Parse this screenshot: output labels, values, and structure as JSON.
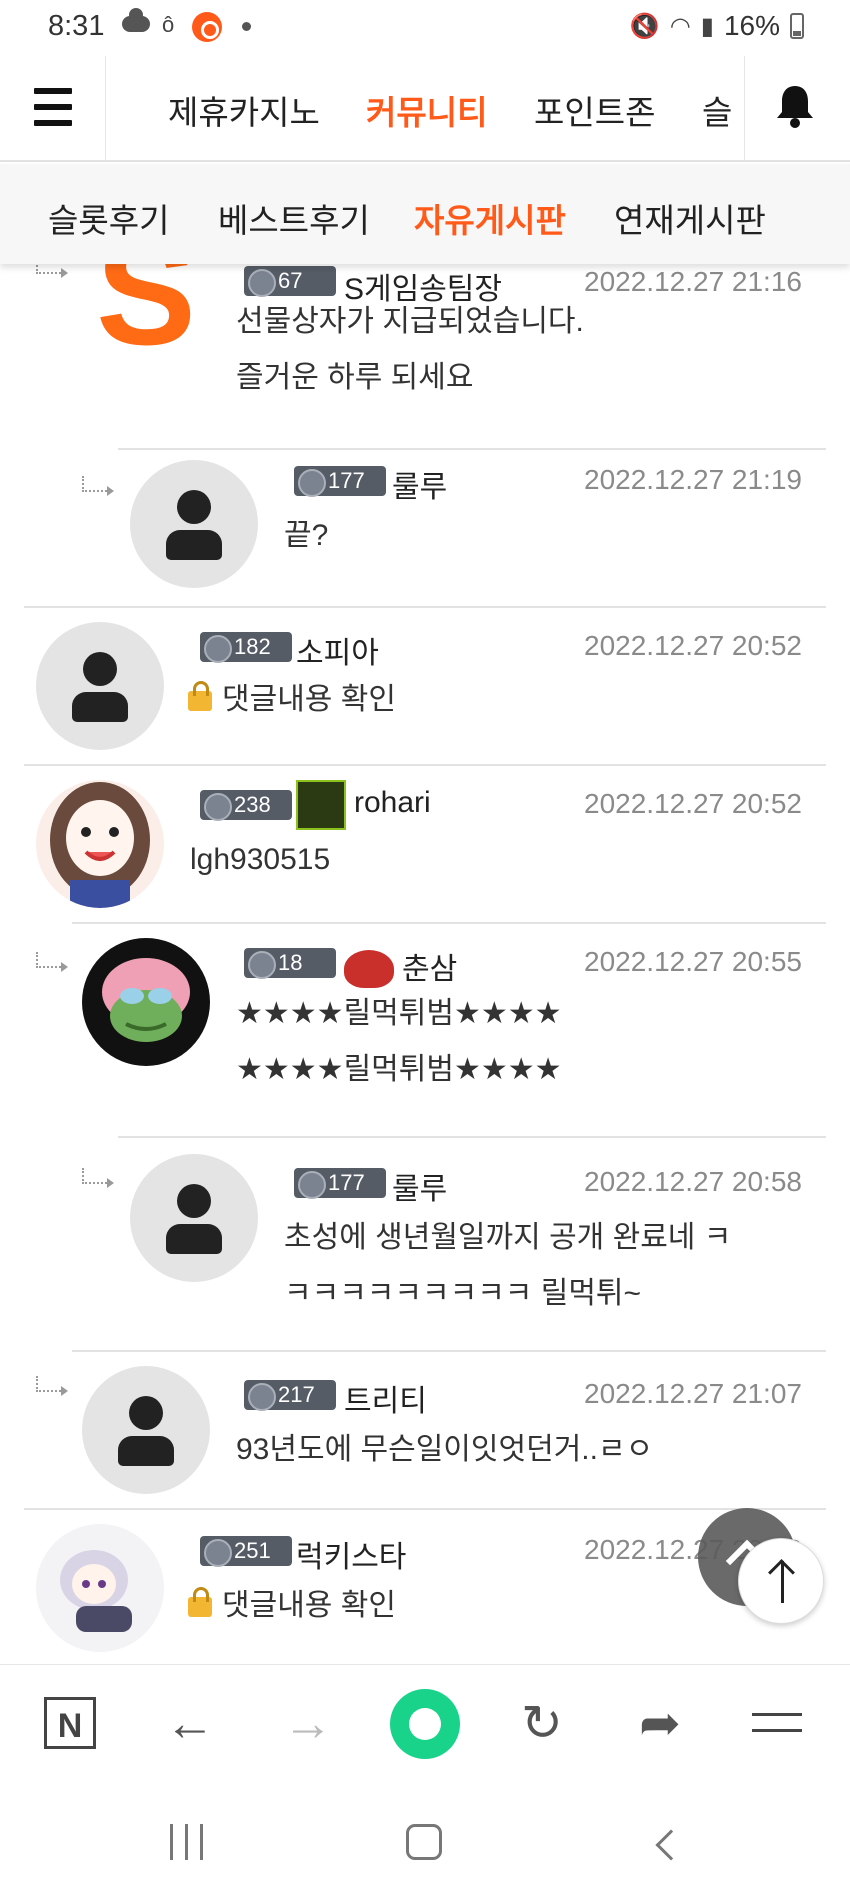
{
  "status_bar": {
    "time": "8:31",
    "battery": "16%"
  },
  "top_nav": {
    "tabs": [
      {
        "label": "제휴카지노"
      },
      {
        "label": "커뮤니티",
        "active": true
      },
      {
        "label": "포인트존"
      },
      {
        "label": "슬"
      }
    ]
  },
  "sub_nav": {
    "tabs": [
      {
        "label": "슬롯후기"
      },
      {
        "label": "베스트후기"
      },
      {
        "label": "자유게시판",
        "active": true
      },
      {
        "label": "연재게시판"
      }
    ]
  },
  "comments": [
    {
      "level": "67",
      "nick": "S게임송팀장",
      "date": "2022.12.27 21:16",
      "lines": [
        "선물상자가 지급되었습니다.",
        "즐거운 하루 되세요"
      ]
    },
    {
      "level": "177",
      "nick": "룰루",
      "date": "2022.12.27 21:19",
      "lines": [
        "끝?"
      ]
    },
    {
      "level": "182",
      "nick": "소피아",
      "date": "2022.12.27 20:52",
      "lines": [
        "댓글내용 확인"
      ]
    },
    {
      "level": "238",
      "nick": "rohari",
      "date": "2022.12.27 20:52",
      "lines": [
        "lgh930515"
      ]
    },
    {
      "level": "18",
      "nick": "춘삼",
      "date": "2022.12.27 20:55",
      "lines": [
        "★★★★릴먹튀범★★★★",
        "★★★★릴먹튀범★★★★"
      ]
    },
    {
      "level": "177",
      "nick": "룰루",
      "date": "2022.12.27 20:58",
      "lines": [
        "초성에 생년월일까지 공개 완료네 ㅋ",
        "ㅋㅋㅋㅋㅋㅋㅋㅋㅋ 릴먹튀~"
      ]
    },
    {
      "level": "217",
      "nick": "트리티",
      "date": "2022.12.27 21:07",
      "lines": [
        "93년도에 무슨일이잇엇던거..ㄹㅇ"
      ]
    },
    {
      "level": "251",
      "nick": "럭키스타",
      "date": "2022.12.27 20:52",
      "lines": [
        "댓글내용 확인"
      ]
    }
  ],
  "browser_bar": {
    "n_label": "N"
  },
  "colors": {
    "accent": "#ff5a1a",
    "date_gray": "#8a8a8a",
    "badge": "#555c66"
  }
}
